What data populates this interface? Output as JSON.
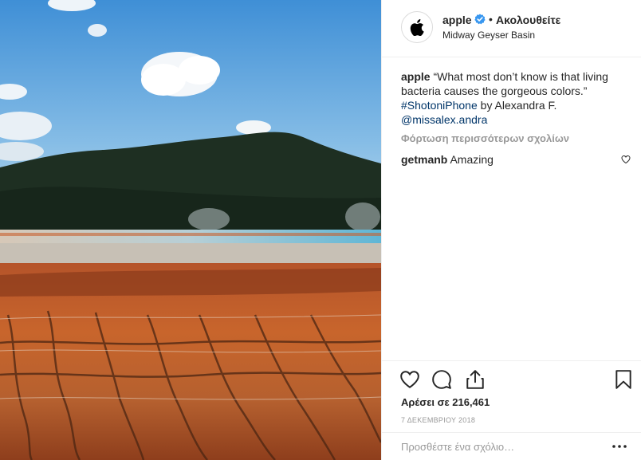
{
  "post": {
    "image_alt": "Grand Prismatic Spring with forested hill and orange bacterial mats",
    "header": {
      "username": "apple",
      "separator": "•",
      "follow_label": "Ακολουθείτε",
      "location": "Midway Geyser Basin"
    },
    "caption": {
      "username": "apple",
      "text": "“What most don’t know is that living bacteria causes the gorgeous colors.”",
      "hashtag": "#ShotoniPhone",
      "by_text": "by Alexandra F.",
      "mention": "@missalex.andra"
    },
    "load_more_comments": "Φόρτωση περισσότερων σχολίων",
    "comments": [
      {
        "username": "getmanb",
        "text": "Amazing"
      }
    ],
    "likes_text": "Αρέσει σε 216,461",
    "date_text": "7 ΔΕΚΕΜΒΡΙΟΥ 2018",
    "add_comment_placeholder": "Προσθέστε ένα σχόλιο…"
  },
  "colors": {
    "text": "#262626",
    "muted": "#999999",
    "link": "#003569",
    "verified": "#3897f0",
    "border": "#efefef"
  }
}
